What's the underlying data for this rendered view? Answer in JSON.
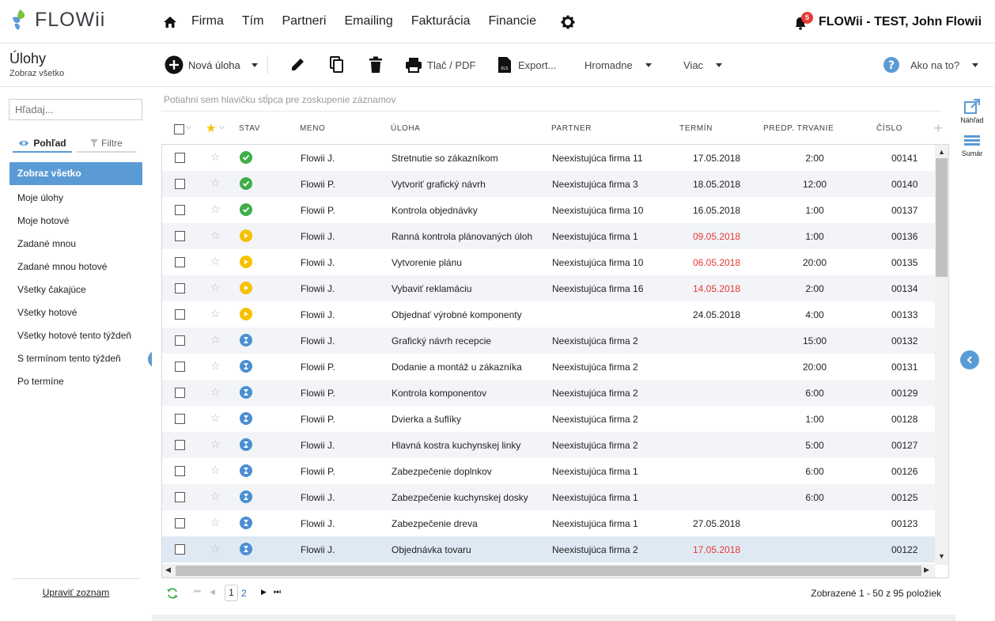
{
  "app": {
    "logo_text": "FLOWii"
  },
  "nav": {
    "items": [
      "Firma",
      "Tím",
      "Partneri",
      "Emailing",
      "Fakturácia",
      "Financie"
    ]
  },
  "user": {
    "notifications": "5",
    "name": "FLOWii - TEST, John Flowii"
  },
  "page": {
    "title": "Úlohy",
    "subtitle": "Zobraz všetko"
  },
  "toolbar": {
    "new_task": "Nová úloha",
    "print": "Tlač / PDF",
    "export": "Export...",
    "bulk": "Hromadne",
    "more": "Viac",
    "help": "Ako na to?"
  },
  "sidebar": {
    "search_placeholder": "Hľadaj...",
    "tab_view": "Pohľad",
    "tab_filters": "Filtre",
    "items": [
      "Zobraz všetko",
      "Moje úlohy",
      "Moje hotové",
      "Zadané mnou",
      "Zadané mnou hotové",
      "Všetky čakajúce",
      "Všetky hotové",
      "Všetky hotové tento týždeň",
      "S termínom tento týždeň",
      "Po termíne"
    ],
    "edit_list": "Upraviť zoznam"
  },
  "grid": {
    "group_hint": "Potiahni sem hlavičku stĺpca pre zoskupenie záznamov",
    "headers": {
      "status": "STAV",
      "name": "MENO",
      "task": "ÚLOHA",
      "partner": "PARTNER",
      "due": "TERMÍN",
      "duration": "PREDP. TRVANIE",
      "number": "ČÍSLO"
    },
    "rows": [
      {
        "status": "done",
        "name": "Flowii J.",
        "task": "Stretnutie so zákazníkom",
        "partner": "Neexistujúca firma 11",
        "due": "17.05.2018",
        "overdue": false,
        "duration": "2:00",
        "number": "00141"
      },
      {
        "status": "done",
        "name": "Flowii P.",
        "task": "Vytvoriť grafický návrh",
        "partner": "Neexistujúca firma 3",
        "due": "18.05.2018",
        "overdue": false,
        "duration": "12:00",
        "number": "00140"
      },
      {
        "status": "done",
        "name": "Flowii P.",
        "task": "Kontrola objednávky",
        "partner": "Neexistujúca firma 10",
        "due": "16.05.2018",
        "overdue": false,
        "duration": "1:00",
        "number": "00137"
      },
      {
        "status": "running",
        "name": "Flowii J.",
        "task": "Ranná kontrola plánovaných úloh",
        "partner": "Neexistujúca firma 1",
        "due": "09.05.2018",
        "overdue": true,
        "duration": "1:00",
        "number": "00136"
      },
      {
        "status": "running",
        "name": "Flowii J.",
        "task": "Vytvorenie plánu",
        "partner": "Neexistujúca firma 10",
        "due": "06.05.2018",
        "overdue": true,
        "duration": "20:00",
        "number": "00135"
      },
      {
        "status": "running",
        "name": "Flowii J.",
        "task": "Vybaviť reklamáciu",
        "partner": "Neexistujúca firma 16",
        "due": "14.05.2018",
        "overdue": true,
        "duration": "2:00",
        "number": "00134"
      },
      {
        "status": "running",
        "name": "Flowii J.",
        "task": "Objednať výrobné komponenty",
        "partner": "",
        "due": "24.05.2018",
        "overdue": false,
        "duration": "4:00",
        "number": "00133"
      },
      {
        "status": "waiting",
        "name": "Flowii J.",
        "task": "Grafický návrh recepcie",
        "partner": "Neexistujúca firma 2",
        "due": "",
        "overdue": false,
        "duration": "15:00",
        "number": "00132"
      },
      {
        "status": "waiting",
        "name": "Flowii P.",
        "task": "Dodanie a montáž u zákazníka",
        "partner": "Neexistujúca firma 2",
        "due": "",
        "overdue": false,
        "duration": "20:00",
        "number": "00131"
      },
      {
        "status": "waiting",
        "name": "Flowii P.",
        "task": "Kontrola komponentov",
        "partner": "Neexistujúca firma 2",
        "due": "",
        "overdue": false,
        "duration": "6:00",
        "number": "00129"
      },
      {
        "status": "waiting",
        "name": "Flowii P.",
        "task": "Dvierka a šuflíky",
        "partner": "Neexistujúca firma 2",
        "due": "",
        "overdue": false,
        "duration": "1:00",
        "number": "00128"
      },
      {
        "status": "waiting",
        "name": "Flowii J.",
        "task": "Hlavná kostra kuchynskej linky",
        "partner": "Neexistujúca firma 2",
        "due": "",
        "overdue": false,
        "duration": "5:00",
        "number": "00127"
      },
      {
        "status": "waiting",
        "name": "Flowii P.",
        "task": "Zabezpečenie doplnkov",
        "partner": "Neexistujúca firma 1",
        "due": "",
        "overdue": false,
        "duration": "6:00",
        "number": "00126"
      },
      {
        "status": "waiting",
        "name": "Flowii J.",
        "task": "Zabezpečenie kuchynskej dosky",
        "partner": "Neexistujúca firma 1",
        "due": "",
        "overdue": false,
        "duration": "6:00",
        "number": "00125"
      },
      {
        "status": "waiting",
        "name": "Flowii J.",
        "task": "Zabezpečenie dreva",
        "partner": "Neexistujúca firma 1",
        "due": "27.05.2018",
        "overdue": false,
        "duration": "",
        "number": "00123"
      },
      {
        "status": "waiting",
        "name": "Flowii J.",
        "task": "Objednávka tovaru",
        "partner": "Neexistujúca firma 2",
        "due": "17.05.2018",
        "overdue": true,
        "duration": "",
        "number": "00122"
      }
    ]
  },
  "pager": {
    "pages": [
      "1",
      "2"
    ],
    "current": "1",
    "info": "Zobrazené 1 - 50 z 95 položiek"
  },
  "rightbar": {
    "preview": "Náhľad",
    "summary": "Sumár"
  },
  "colors": {
    "accent": "#5b9bd5",
    "done": "#3fae49",
    "running": "#f6c200",
    "waiting": "#4a8fd2",
    "overdue": "#e53935"
  }
}
